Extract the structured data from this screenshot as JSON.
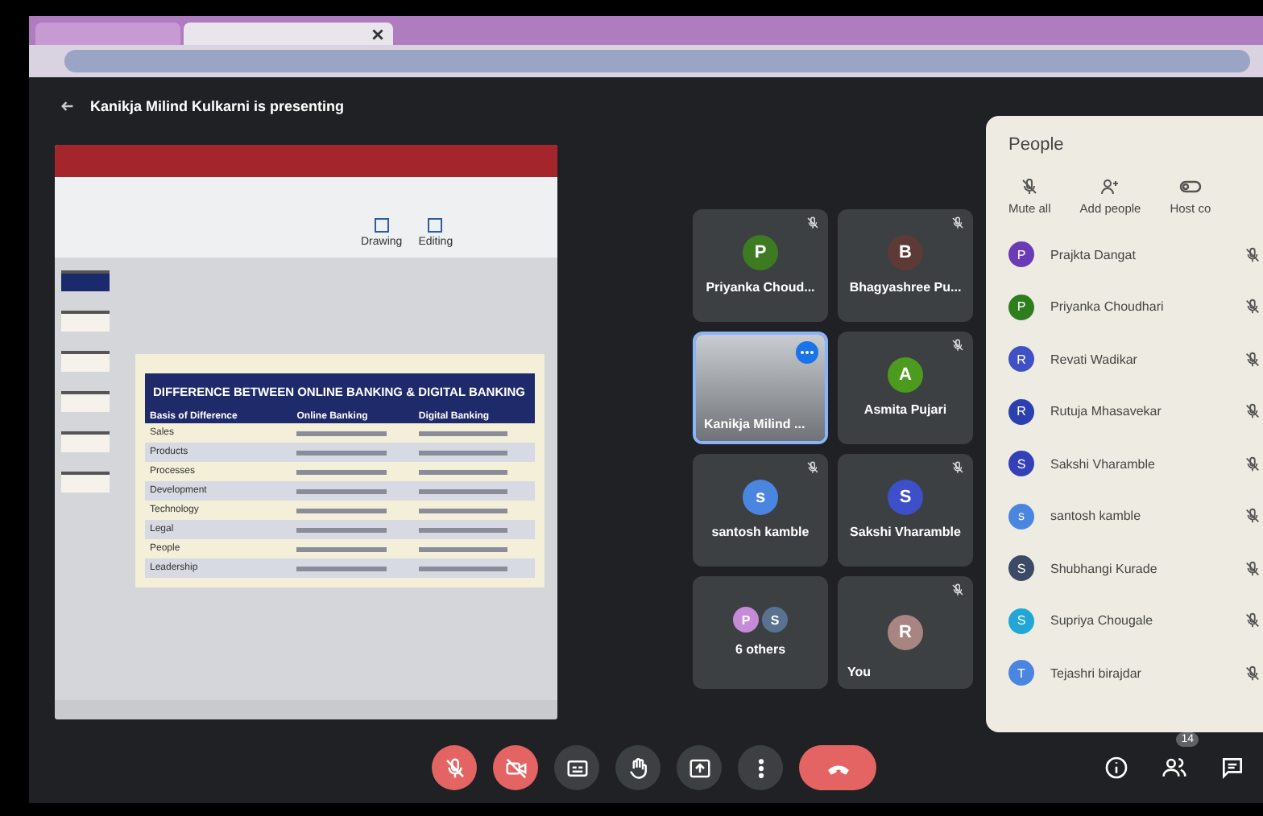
{
  "meeting": {
    "presenter_banner": "Kanikja Milind Kulkarni is presenting"
  },
  "slide_window": {
    "ribbon_groups": [
      "Drawing",
      "Editing"
    ],
    "slide": {
      "title": "DIFFERENCE BETWEEN ONLINE BANKING & DIGITAL BANKING",
      "columns": [
        "Basis of Difference",
        "Online Banking",
        "Digital Banking"
      ],
      "rows": [
        "Sales",
        "Products",
        "Processes",
        "Development",
        "Technology",
        "Legal",
        "People",
        "Leadership"
      ]
    }
  },
  "tiles": [
    {
      "kind": "avatar",
      "name": "Priyanka Choud...",
      "initial": "P",
      "color": "#3d7a22",
      "muted": true,
      "selected": false
    },
    {
      "kind": "avatar",
      "name": "Bhagyashree Pu...",
      "initial": "B",
      "color": "#5d3a36",
      "muted": true,
      "selected": false
    },
    {
      "kind": "video",
      "name": "Kanikja Milind ...",
      "selected": true
    },
    {
      "kind": "avatar",
      "name": "Asmita Pujari",
      "initial": "A",
      "color": "#4c9a1e",
      "muted": true,
      "selected": false
    },
    {
      "kind": "avatar",
      "name": "santosh kamble",
      "initial": "s",
      "color": "#4a86e0",
      "muted": true,
      "selected": false
    },
    {
      "kind": "avatar",
      "name": "Sakshi Vharamble",
      "initial": "S",
      "color": "#3d4fc9",
      "muted": true,
      "selected": false
    },
    {
      "kind": "others",
      "name": "6 others",
      "initials": [
        {
          "initial": "P",
          "color": "#c58bd8"
        },
        {
          "initial": "S",
          "color": "#5a7190"
        }
      ],
      "selected": false
    },
    {
      "kind": "avatar",
      "name": "You",
      "initial": "R",
      "color": "#a88580",
      "muted": true,
      "selected": false
    }
  ],
  "people_panel": {
    "title": "People",
    "actions": [
      {
        "kind": "mute",
        "label": "Mute all"
      },
      {
        "kind": "add",
        "label": "Add people"
      },
      {
        "kind": "host",
        "label": "Host co"
      }
    ],
    "participants": [
      {
        "name": "Prajkta Dangat",
        "initial": "P",
        "color": "#6a3bb5",
        "muted": true
      },
      {
        "name": "Priyanka Choudhari",
        "initial": "P",
        "color": "#2e7d1e",
        "muted": true
      },
      {
        "name": "Revati Wadikar",
        "initial": "R",
        "color": "#3f51c5",
        "muted": true
      },
      {
        "name": "Rutuja Mhasavekar",
        "initial": "R",
        "color": "#2c3fae",
        "muted": true
      },
      {
        "name": "Sakshi Vharamble",
        "initial": "S",
        "color": "#3340b8",
        "muted": true
      },
      {
        "name": "santosh kamble",
        "initial": "s",
        "color": "#4a86e0",
        "muted": true
      },
      {
        "name": "Shubhangi Kurade",
        "initial": "S",
        "color": "#3c4a66",
        "muted": true
      },
      {
        "name": "Supriya Chougale",
        "initial": "S",
        "color": "#22a6d6",
        "muted": true
      },
      {
        "name": "Tejashri birajdar",
        "initial": "T",
        "color": "#4a86e0",
        "muted": true
      }
    ]
  },
  "controls": [
    {
      "kind": "mic",
      "alert": true
    },
    {
      "kind": "camera",
      "alert": true
    },
    {
      "kind": "captions",
      "alert": false
    },
    {
      "kind": "hand",
      "alert": false
    },
    {
      "kind": "present",
      "alert": false
    },
    {
      "kind": "more",
      "alert": false
    },
    {
      "kind": "end",
      "alert": true
    }
  ],
  "side_controls": [
    {
      "kind": "info"
    },
    {
      "kind": "people",
      "badge": "14"
    },
    {
      "kind": "chat"
    }
  ]
}
